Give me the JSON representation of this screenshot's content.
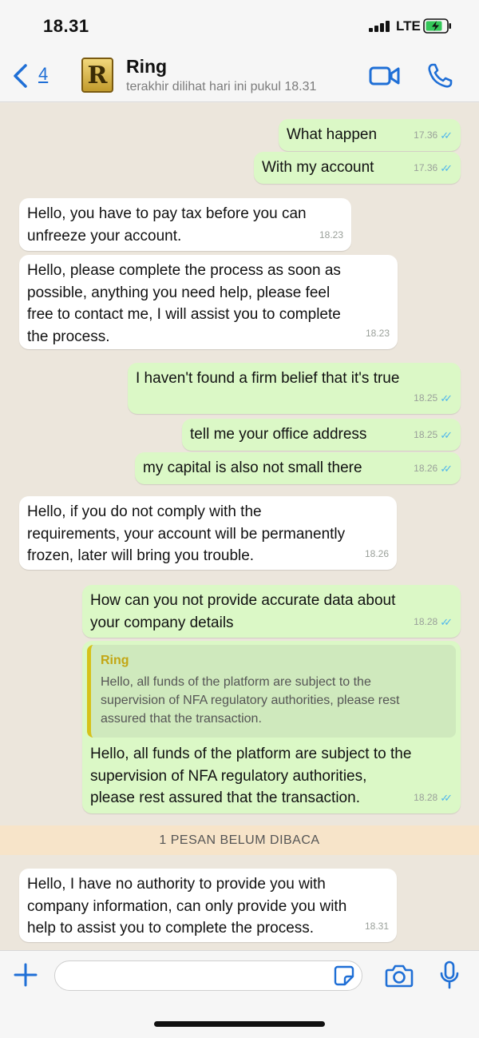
{
  "status_bar": {
    "time": "18.31",
    "network": "LTE"
  },
  "header": {
    "back_count": "4",
    "avatar_letter": "R",
    "contact_name": "Ring",
    "last_seen": "terakhir dilihat hari ini pukul 18.31"
  },
  "messages": [
    {
      "dir": "out",
      "text": "What happen",
      "time": "17.36"
    },
    {
      "dir": "out",
      "text": "With my account",
      "time": "17.36"
    },
    {
      "dir": "in",
      "text": "Hello, you have to pay tax before you can\nunfreeze your account.",
      "time": "18.23"
    },
    {
      "dir": "in",
      "text": "Hello, please complete the process as soon as\npossible, anything you need help, please feel\nfree to contact me, I will assist you to complete\nthe process.",
      "time": "18.23"
    },
    {
      "dir": "out",
      "text": "I haven't found a firm belief that it's true",
      "time": "18.25"
    },
    {
      "dir": "out",
      "text": "tell me your office address",
      "time": "18.25"
    },
    {
      "dir": "out",
      "text": "my capital is also not small there",
      "time": "18.26"
    },
    {
      "dir": "in",
      "text": "Hello, if you do not comply with the\nrequirements, your account will be permanently\nfrozen, later will bring you trouble.",
      "time": "18.26"
    },
    {
      "dir": "out",
      "text": "How can you not provide accurate data about\nyour company details",
      "time": "18.28"
    },
    {
      "dir": "out",
      "quote_name": "Ring",
      "quote_text": "Hello, all funds of the platform are subject to the\nsupervision of NFA regulatory authorities, please rest\nassured that the transaction.",
      "text": "Hello, all funds of the platform are subject to the\nsupervision of NFA regulatory authorities,\nplease rest assured that the transaction.",
      "time": "18.28"
    },
    {
      "dir": "in",
      "text": "Hello, I have no authority to provide you with\ncompany information, can only provide you with\nhelp to assist you to complete the process.",
      "time": "18.31"
    }
  ],
  "unread_banner": "1 PESAN BELUM DIBACA",
  "input": {
    "placeholder": ""
  },
  "colors": {
    "accent": "#1f6fd6",
    "outgoing_bubble": "#dbf8c6",
    "incoming_bubble": "#ffffff",
    "read_ticks": "#4fb6ec",
    "unread_banner": "#f7e4c9"
  },
  "icons": [
    "back-chevron-icon",
    "video-call-icon",
    "phone-call-icon",
    "plus-icon",
    "sticker-icon",
    "camera-icon",
    "microphone-icon"
  ]
}
